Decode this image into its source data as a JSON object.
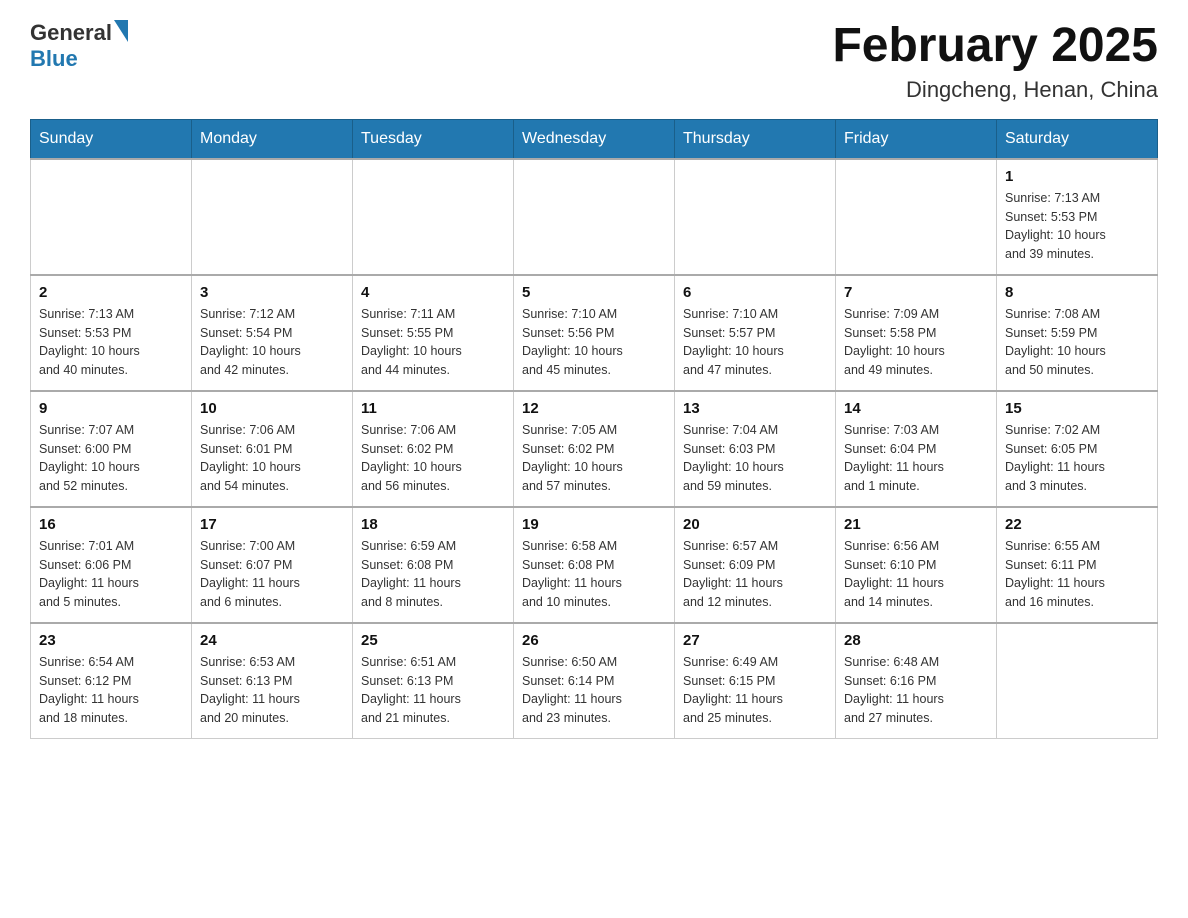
{
  "header": {
    "logo_general": "General",
    "logo_blue": "Blue",
    "title": "February 2025",
    "subtitle": "Dingcheng, Henan, China"
  },
  "weekdays": [
    "Sunday",
    "Monday",
    "Tuesday",
    "Wednesday",
    "Thursday",
    "Friday",
    "Saturday"
  ],
  "weeks": [
    [
      {
        "day": "",
        "info": ""
      },
      {
        "day": "",
        "info": ""
      },
      {
        "day": "",
        "info": ""
      },
      {
        "day": "",
        "info": ""
      },
      {
        "day": "",
        "info": ""
      },
      {
        "day": "",
        "info": ""
      },
      {
        "day": "1",
        "info": "Sunrise: 7:13 AM\nSunset: 5:53 PM\nDaylight: 10 hours\nand 39 minutes."
      }
    ],
    [
      {
        "day": "2",
        "info": "Sunrise: 7:13 AM\nSunset: 5:53 PM\nDaylight: 10 hours\nand 40 minutes."
      },
      {
        "day": "3",
        "info": "Sunrise: 7:12 AM\nSunset: 5:54 PM\nDaylight: 10 hours\nand 42 minutes."
      },
      {
        "day": "4",
        "info": "Sunrise: 7:11 AM\nSunset: 5:55 PM\nDaylight: 10 hours\nand 44 minutes."
      },
      {
        "day": "5",
        "info": "Sunrise: 7:10 AM\nSunset: 5:56 PM\nDaylight: 10 hours\nand 45 minutes."
      },
      {
        "day": "6",
        "info": "Sunrise: 7:10 AM\nSunset: 5:57 PM\nDaylight: 10 hours\nand 47 minutes."
      },
      {
        "day": "7",
        "info": "Sunrise: 7:09 AM\nSunset: 5:58 PM\nDaylight: 10 hours\nand 49 minutes."
      },
      {
        "day": "8",
        "info": "Sunrise: 7:08 AM\nSunset: 5:59 PM\nDaylight: 10 hours\nand 50 minutes."
      }
    ],
    [
      {
        "day": "9",
        "info": "Sunrise: 7:07 AM\nSunset: 6:00 PM\nDaylight: 10 hours\nand 52 minutes."
      },
      {
        "day": "10",
        "info": "Sunrise: 7:06 AM\nSunset: 6:01 PM\nDaylight: 10 hours\nand 54 minutes."
      },
      {
        "day": "11",
        "info": "Sunrise: 7:06 AM\nSunset: 6:02 PM\nDaylight: 10 hours\nand 56 minutes."
      },
      {
        "day": "12",
        "info": "Sunrise: 7:05 AM\nSunset: 6:02 PM\nDaylight: 10 hours\nand 57 minutes."
      },
      {
        "day": "13",
        "info": "Sunrise: 7:04 AM\nSunset: 6:03 PM\nDaylight: 10 hours\nand 59 minutes."
      },
      {
        "day": "14",
        "info": "Sunrise: 7:03 AM\nSunset: 6:04 PM\nDaylight: 11 hours\nand 1 minute."
      },
      {
        "day": "15",
        "info": "Sunrise: 7:02 AM\nSunset: 6:05 PM\nDaylight: 11 hours\nand 3 minutes."
      }
    ],
    [
      {
        "day": "16",
        "info": "Sunrise: 7:01 AM\nSunset: 6:06 PM\nDaylight: 11 hours\nand 5 minutes."
      },
      {
        "day": "17",
        "info": "Sunrise: 7:00 AM\nSunset: 6:07 PM\nDaylight: 11 hours\nand 6 minutes."
      },
      {
        "day": "18",
        "info": "Sunrise: 6:59 AM\nSunset: 6:08 PM\nDaylight: 11 hours\nand 8 minutes."
      },
      {
        "day": "19",
        "info": "Sunrise: 6:58 AM\nSunset: 6:08 PM\nDaylight: 11 hours\nand 10 minutes."
      },
      {
        "day": "20",
        "info": "Sunrise: 6:57 AM\nSunset: 6:09 PM\nDaylight: 11 hours\nand 12 minutes."
      },
      {
        "day": "21",
        "info": "Sunrise: 6:56 AM\nSunset: 6:10 PM\nDaylight: 11 hours\nand 14 minutes."
      },
      {
        "day": "22",
        "info": "Sunrise: 6:55 AM\nSunset: 6:11 PM\nDaylight: 11 hours\nand 16 minutes."
      }
    ],
    [
      {
        "day": "23",
        "info": "Sunrise: 6:54 AM\nSunset: 6:12 PM\nDaylight: 11 hours\nand 18 minutes."
      },
      {
        "day": "24",
        "info": "Sunrise: 6:53 AM\nSunset: 6:13 PM\nDaylight: 11 hours\nand 20 minutes."
      },
      {
        "day": "25",
        "info": "Sunrise: 6:51 AM\nSunset: 6:13 PM\nDaylight: 11 hours\nand 21 minutes."
      },
      {
        "day": "26",
        "info": "Sunrise: 6:50 AM\nSunset: 6:14 PM\nDaylight: 11 hours\nand 23 minutes."
      },
      {
        "day": "27",
        "info": "Sunrise: 6:49 AM\nSunset: 6:15 PM\nDaylight: 11 hours\nand 25 minutes."
      },
      {
        "day": "28",
        "info": "Sunrise: 6:48 AM\nSunset: 6:16 PM\nDaylight: 11 hours\nand 27 minutes."
      },
      {
        "day": "",
        "info": ""
      }
    ]
  ]
}
